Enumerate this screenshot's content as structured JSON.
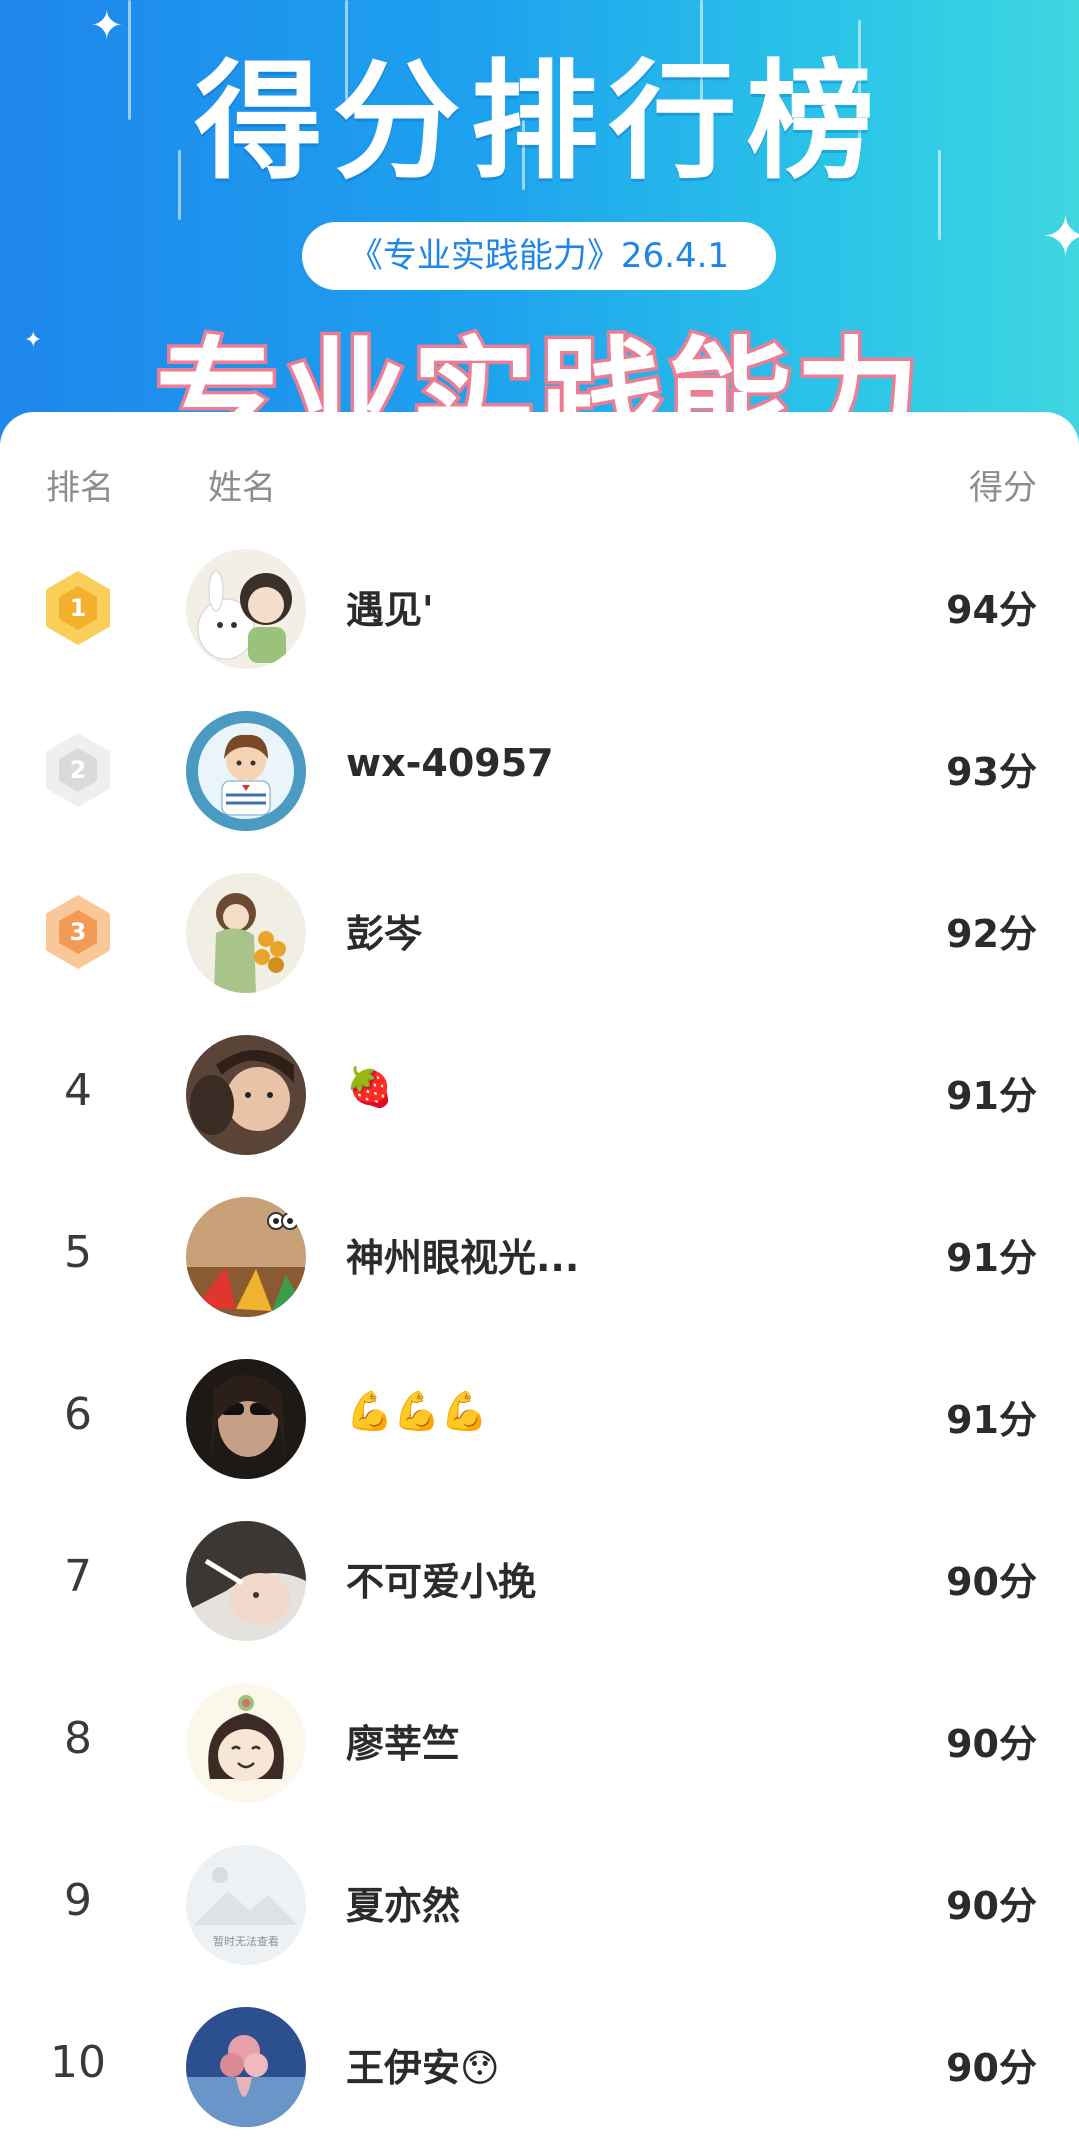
{
  "banner": {
    "title": "得分排行榜",
    "pill": "《专业实践能力》26.4.1",
    "subtitle": "专业实践能力"
  },
  "columns": {
    "rank": "排名",
    "name": "姓名",
    "score": "得分"
  },
  "colors": {
    "gold": "#f5b431",
    "silver": "#e3e3e3",
    "bronze": "#f3a061",
    "accent": "#1f86e8",
    "subtitle_stroke": "#ec7d92"
  },
  "rows": [
    {
      "rank": "1",
      "name": "遇见'",
      "score": "94分"
    },
    {
      "rank": "2",
      "name": "wx-40957",
      "score": "93分"
    },
    {
      "rank": "3",
      "name": "彭岑",
      "score": "92分"
    },
    {
      "rank": "4",
      "name": "🍓",
      "score": "91分"
    },
    {
      "rank": "5",
      "name": "神州眼视光...",
      "score": "91分"
    },
    {
      "rank": "6",
      "name": "💪💪💪",
      "score": "91分"
    },
    {
      "rank": "7",
      "name": "不可爱小挽",
      "score": "90分"
    },
    {
      "rank": "8",
      "name": "廖莘竺",
      "score": "90分"
    },
    {
      "rank": "9",
      "name": "夏亦然",
      "score": "90分"
    },
    {
      "rank": "10",
      "name": "王伊安😯",
      "score": "90分"
    }
  ],
  "avatar_placeholder_text": "暂时无法查看"
}
